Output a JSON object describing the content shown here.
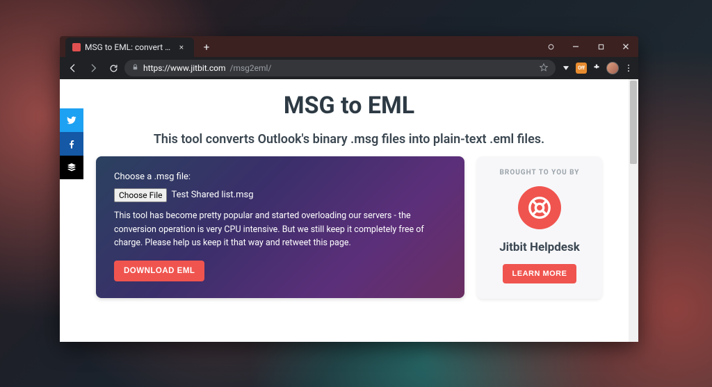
{
  "browser": {
    "tab_title": "MSG to EML: convert Outlook .m…",
    "url_host": "https://www.jitbit.com",
    "url_path": "/msg2eml/"
  },
  "page": {
    "title": "MSG to EML",
    "subtitle": "This tool converts Outlook's binary .msg files into plain-text .eml files."
  },
  "panel": {
    "choose_label": "Choose a .msg file:",
    "choose_button": "Choose File",
    "chosen_file": "Test Shared list.msg",
    "note": "This tool has become pretty popular and started overloading our servers - the conversion operation is very CPU intensive. But we still keep it completely free of charge. Please help us keep it that way and retweet this page.",
    "download_label": "DOWNLOAD EML"
  },
  "promo": {
    "heading": "BROUGHT TO YOU BY",
    "brand": "Jitbit Helpdesk",
    "learn_more": "LEARN MORE"
  },
  "colors": {
    "accent": "#f0544f",
    "gradient_start": "#2b4160",
    "gradient_end": "#6a2f62"
  },
  "share": {
    "twitter": "twitter",
    "facebook": "facebook",
    "buffer": "buffer"
  }
}
